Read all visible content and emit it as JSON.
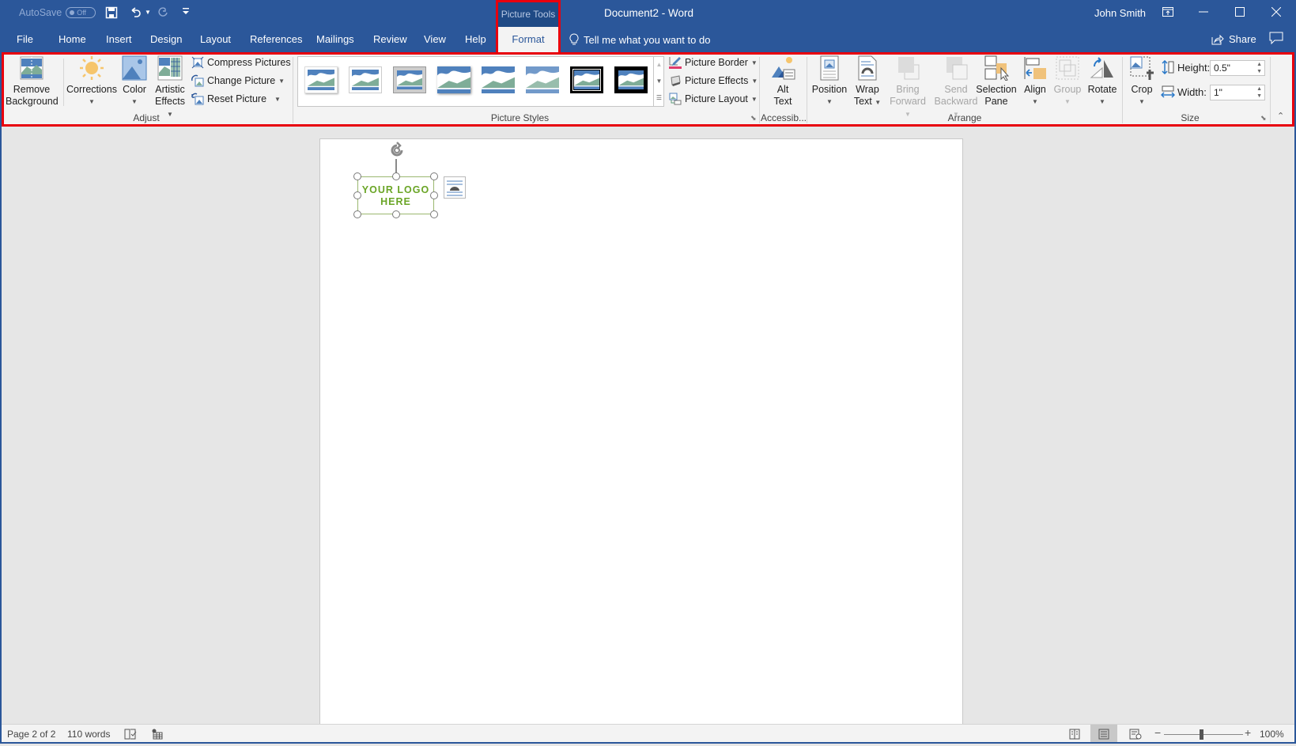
{
  "titlebar": {
    "autosave_label": "AutoSave",
    "autosave_state": "Off",
    "context_header": "Picture Tools",
    "document_title": "Document2  -  Word",
    "user_name": "John Smith",
    "icons": [
      "save-icon",
      "undo-icon",
      "redo-icon",
      "customize-qat-icon",
      "ribbon-display-options-icon",
      "minimize-icon",
      "maximize-icon",
      "close-icon"
    ]
  },
  "tabs": [
    {
      "label": "File"
    },
    {
      "label": "Home"
    },
    {
      "label": "Insert"
    },
    {
      "label": "Design"
    },
    {
      "label": "Layout"
    },
    {
      "label": "References"
    },
    {
      "label": "Mailings"
    },
    {
      "label": "Review"
    },
    {
      "label": "View"
    },
    {
      "label": "Help"
    },
    {
      "label": "Format",
      "active": true
    }
  ],
  "tellme": {
    "placeholder": "Tell me what you want to do"
  },
  "share": {
    "label": "Share"
  },
  "ribbon": {
    "groups": {
      "adjust": {
        "label": "Adjust",
        "remove_background": "Remove Background",
        "corrections": "Corrections",
        "color": "Color",
        "artistic_effects": "Artistic Effects",
        "compress_pictures": "Compress Pictures",
        "change_picture": "Change Picture",
        "reset_picture": "Reset Picture"
      },
      "picture_styles": {
        "label": "Picture Styles",
        "styles_count": 8,
        "picture_border": "Picture Border",
        "picture_effects": "Picture Effects",
        "picture_layout": "Picture Layout",
        "border_color": "#e03a6c"
      },
      "accessibility": {
        "label": "Accessib...",
        "alt_text": "Alt Text"
      },
      "arrange": {
        "label": "Arrange",
        "position": "Position",
        "wrap_text": "Wrap Text",
        "bring_forward": "Bring Forward",
        "send_backward": "Send Backward",
        "selection_pane": "Selection Pane",
        "align": "Align",
        "group": "Group",
        "rotate": "Rotate"
      },
      "size": {
        "label": "Size",
        "crop": "Crop",
        "height_label": "Height:",
        "height_value": "0.5\"",
        "width_label": "Width:",
        "width_value": "1\""
      }
    }
  },
  "document": {
    "logo_text_line1": "YOUR LOGO",
    "logo_text_line2": "HERE",
    "logo_color": "#6aa526"
  },
  "statusbar": {
    "page": "Page 2 of 2",
    "words": "110 words",
    "zoom": "100%"
  },
  "colors": {
    "brand": "#2b579a",
    "highlight": "#e8000d"
  }
}
